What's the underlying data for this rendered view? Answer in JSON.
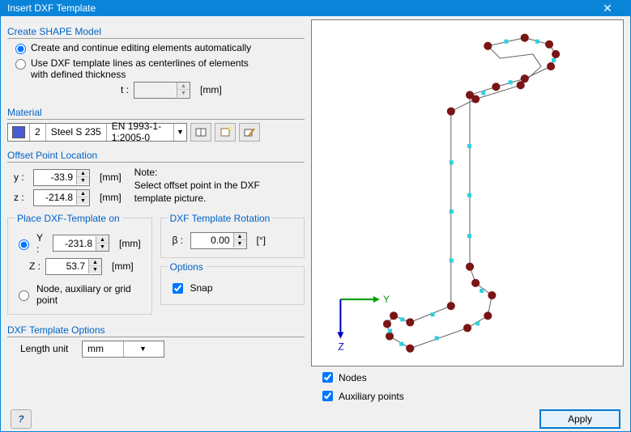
{
  "title": "Insert DXF Template",
  "shape": {
    "header": "Create SHAPE Model",
    "opt1": "Create and continue editing elements automatically",
    "opt2": "Use DXF template lines as centerlines of elements with defined thickness",
    "t_label": "t :",
    "t_value": "",
    "t_unit": "[mm]"
  },
  "material": {
    "header": "Material",
    "num": "2",
    "name": "Steel S 235",
    "standard": "EN 1993-1-1:2005-0"
  },
  "offset": {
    "header": "Offset Point Location",
    "y_label": "y :",
    "y_value": "-33.9",
    "y_unit": "[mm]",
    "z_label": "z :",
    "z_value": "-214.8",
    "z_unit": "[mm]",
    "note_hdr": "Note:",
    "note_txt": "Select offset point in the DXF template picture."
  },
  "place": {
    "header": "Place DXF-Template on",
    "Y_label": "Y :",
    "Y_value": "-231.8",
    "Y_unit": "[mm]",
    "Z_label": "Z :",
    "Z_value": "53.7",
    "Z_unit": "[mm]",
    "node_label": "Node, auxiliary or grid point"
  },
  "rotation": {
    "header": "DXF Template Rotation",
    "beta_label": "β :",
    "beta_value": "0.00",
    "beta_unit": "[°]"
  },
  "options": {
    "header": "Options",
    "snap": "Snap"
  },
  "dxfopt": {
    "header": "DXF Template Options",
    "length_label": "Length unit",
    "length_value": "mm"
  },
  "preview": {
    "nodes_label": "Nodes",
    "aux_label": "Auxiliary points",
    "y_axis": "Y",
    "z_axis": "Z"
  },
  "footer": {
    "apply": "Apply"
  }
}
